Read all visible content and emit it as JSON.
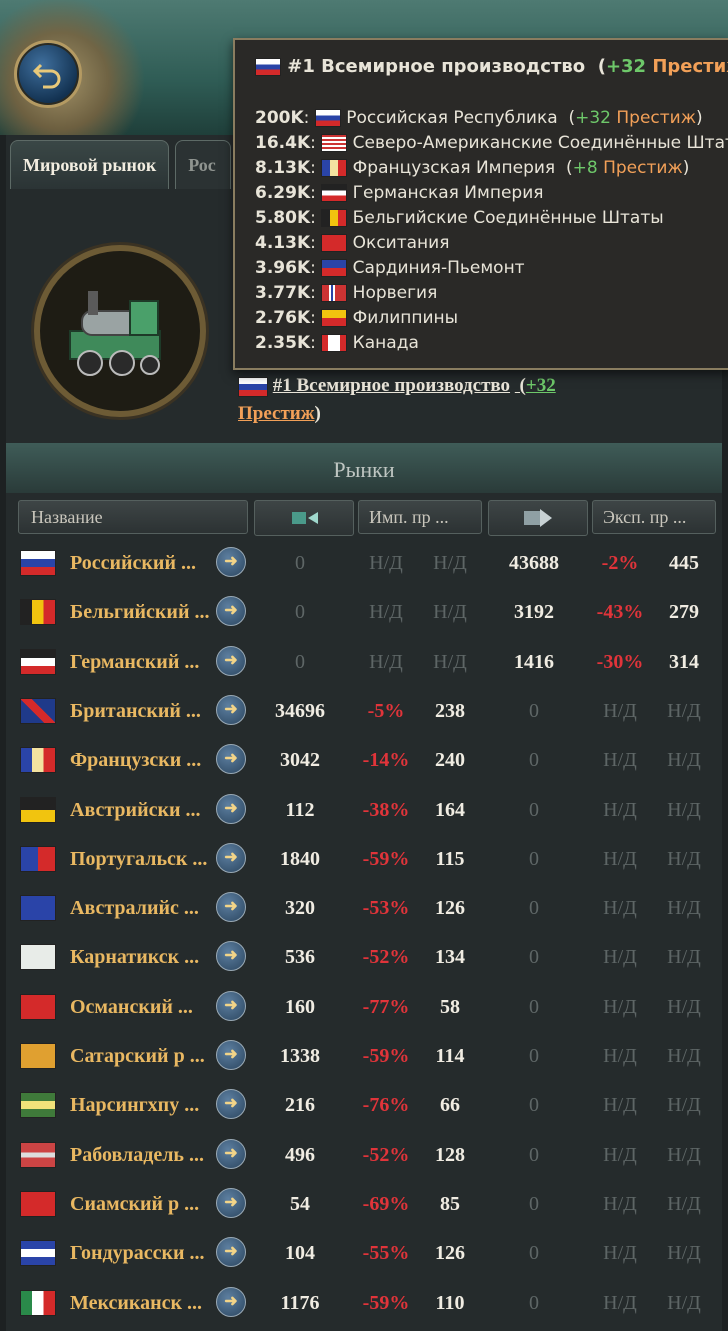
{
  "tabs": {
    "active": "Мировой рынок",
    "second": "Рос"
  },
  "tooltip": {
    "title_rank": "#1 Всемирное производство",
    "title_bonus": "+32",
    "title_prestige": "Престиж",
    "rows": [
      {
        "value": "200K",
        "country": "Российская Республика",
        "bonus": "+32",
        "prestige": "Престиж",
        "flag": "russia"
      },
      {
        "value": "16.4K",
        "country": "Северо-Американские Соединённые Штаты",
        "flag": "usa"
      },
      {
        "value": "8.13K",
        "country": "Французская Империя",
        "bonus": "+8",
        "prestige": "Престиж",
        "flag": "france"
      },
      {
        "value": "6.29K",
        "country": "Германская Империя",
        "flag": "germany"
      },
      {
        "value": "5.80K",
        "country": "Бельгийские Соединённые Штаты",
        "flag": "belgium"
      },
      {
        "value": "4.13K",
        "country": "Окситания",
        "flag": "occitania"
      },
      {
        "value": "3.96K",
        "country": "Сардиния-Пьемонт",
        "flag": "sardinia"
      },
      {
        "value": "3.77K",
        "country": "Норвегия",
        "flag": "norway"
      },
      {
        "value": "2.76K",
        "country": "Филиппины",
        "flag": "philippines"
      },
      {
        "value": "2.35K",
        "country": "Канада",
        "flag": "canada"
      }
    ]
  },
  "info": {
    "rank": "#1 Всемирное производство",
    "bonus": "+32",
    "prestige": "Престиж"
  },
  "section_title": "Рынки",
  "columns": {
    "name": "Название",
    "import_icon": "import-icon",
    "import_price": "Имп. пр ...",
    "export_icon": "export-icon",
    "export_price": "Эксп. пр ..."
  },
  "markets": [
    {
      "name": "Российский ...",
      "imp": "0",
      "imp_pct": "Н/Д",
      "imp_p": "Н/Д",
      "exp": "43688",
      "exp_pct": "-2%",
      "exp_p": "445",
      "flag": "russia",
      "mode": "exp"
    },
    {
      "name": "Бельгийский ...",
      "imp": "0",
      "imp_pct": "Н/Д",
      "imp_p": "Н/Д",
      "exp": "3192",
      "exp_pct": "-43%",
      "exp_p": "279",
      "flag": "belgium",
      "mode": "exp"
    },
    {
      "name": "Германский ...",
      "imp": "0",
      "imp_pct": "Н/Д",
      "imp_p": "Н/Д",
      "exp": "1416",
      "exp_pct": "-30%",
      "exp_p": "314",
      "flag": "germany",
      "mode": "exp"
    },
    {
      "name": "Британский ...",
      "imp": "34696",
      "imp_pct": "-5%",
      "imp_p": "238",
      "exp": "0",
      "exp_pct": "Н/Д",
      "exp_p": "Н/Д",
      "flag": "britain",
      "mode": "imp"
    },
    {
      "name": "Французски ...",
      "imp": "3042",
      "imp_pct": "-14%",
      "imp_p": "240",
      "exp": "0",
      "exp_pct": "Н/Д",
      "exp_p": "Н/Д",
      "flag": "france",
      "mode": "imp"
    },
    {
      "name": "Австрийски ...",
      "imp": "112",
      "imp_pct": "-38%",
      "imp_p": "164",
      "exp": "0",
      "exp_pct": "Н/Д",
      "exp_p": "Н/Д",
      "flag": "austria",
      "mode": "imp"
    },
    {
      "name": "Португальск ...",
      "imp": "1840",
      "imp_pct": "-59%",
      "imp_p": "115",
      "exp": "0",
      "exp_pct": "Н/Д",
      "exp_p": "Н/Д",
      "flag": "portugal",
      "mode": "imp"
    },
    {
      "name": "Австралийс ...",
      "imp": "320",
      "imp_pct": "-53%",
      "imp_p": "126",
      "exp": "0",
      "exp_pct": "Н/Д",
      "exp_p": "Н/Д",
      "flag": "australia",
      "mode": "imp"
    },
    {
      "name": "Карнатикск ...",
      "imp": "536",
      "imp_pct": "-52%",
      "imp_p": "134",
      "exp": "0",
      "exp_pct": "Н/Д",
      "exp_p": "Н/Д",
      "flag": "carnatic",
      "mode": "imp"
    },
    {
      "name": "Османский ...",
      "imp": "160",
      "imp_pct": "-77%",
      "imp_p": "58",
      "exp": "0",
      "exp_pct": "Н/Д",
      "exp_p": "Н/Д",
      "flag": "ottoman",
      "mode": "imp"
    },
    {
      "name": "Сатарский р ...",
      "imp": "1338",
      "imp_pct": "-59%",
      "imp_p": "114",
      "exp": "0",
      "exp_pct": "Н/Д",
      "exp_p": "Н/Д",
      "flag": "satara",
      "mode": "imp"
    },
    {
      "name": "Нарсингхпу ...",
      "imp": "216",
      "imp_pct": "-76%",
      "imp_p": "66",
      "exp": "0",
      "exp_pct": "Н/Д",
      "exp_p": "Н/Д",
      "flag": "narsinghpur",
      "mode": "imp"
    },
    {
      "name": "Рабовладель ...",
      "imp": "496",
      "imp_pct": "-52%",
      "imp_p": "128",
      "exp": "0",
      "exp_pct": "Н/Д",
      "exp_p": "Н/Д",
      "flag": "slaveholder",
      "mode": "imp"
    },
    {
      "name": "Сиамский р ...",
      "imp": "54",
      "imp_pct": "-69%",
      "imp_p": "85",
      "exp": "0",
      "exp_pct": "Н/Д",
      "exp_p": "Н/Д",
      "flag": "siam",
      "mode": "imp"
    },
    {
      "name": "Гондурасски ...",
      "imp": "104",
      "imp_pct": "-55%",
      "imp_p": "126",
      "exp": "0",
      "exp_pct": "Н/Д",
      "exp_p": "Н/Д",
      "flag": "honduras",
      "mode": "imp"
    },
    {
      "name": "Мексиканск ...",
      "imp": "1176",
      "imp_pct": "-59%",
      "imp_p": "110",
      "exp": "0",
      "exp_pct": "Н/Д",
      "exp_p": "Н/Д",
      "flag": "mexico",
      "mode": "imp"
    }
  ]
}
